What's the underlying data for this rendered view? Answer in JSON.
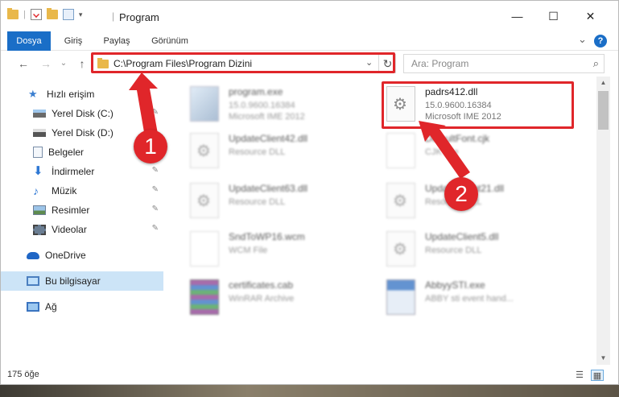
{
  "window": {
    "title": "Program",
    "qat_separator": "|",
    "minimize_glyph": "—",
    "maximize_glyph": "☐",
    "close_glyph": "✕"
  },
  "ribbon": {
    "tabs": [
      "Dosya",
      "Giriş",
      "Paylaş",
      "Görünüm"
    ],
    "expand_glyph": "⌄",
    "help_glyph": "?"
  },
  "nav": {
    "back": "←",
    "forward": "→",
    "recent": "⌄",
    "up": "↑",
    "address_path": "C:\\Program Files\\Program Dizini",
    "dropdown_glyph": "⌄",
    "refresh_glyph": "↻",
    "search_placeholder": "Ara: Program",
    "search_glyph": "⌕"
  },
  "sidebar": {
    "items": [
      {
        "label": "Hızlı erişim",
        "icon": "star-icon",
        "pinned": false
      },
      {
        "label": "Yerel Disk (C:)",
        "icon": "drive-icon",
        "pinned": true
      },
      {
        "label": "Yerel Disk (D:)",
        "icon": "drive-icon",
        "pinned": true
      },
      {
        "label": "Belgeler",
        "icon": "documents-icon",
        "pinned": false
      },
      {
        "label": "İndirmeler",
        "icon": "download-icon",
        "pinned": true
      },
      {
        "label": "Müzik",
        "icon": "music-icon",
        "pinned": true
      },
      {
        "label": "Resimler",
        "icon": "pictures-icon",
        "pinned": true
      },
      {
        "label": "Videolar",
        "icon": "videos-icon",
        "pinned": true
      },
      {
        "label": "OneDrive",
        "icon": "cloud-icon",
        "pinned": false
      },
      {
        "label": "Bu bilgisayar",
        "icon": "computer-icon",
        "pinned": false
      },
      {
        "label": "Ağ",
        "icon": "network-icon",
        "pinned": false
      }
    ],
    "pin_glyph": "📌"
  },
  "files": [
    {
      "name": "program.exe",
      "line2": "15.0.9600.16384",
      "line3": "Microsoft IME 2012",
      "icon": "exe-icon"
    },
    {
      "name": "padrs412.dll",
      "line2": "15.0.9600.16384",
      "line3": "Microsoft IME 2012",
      "icon": "dll-icon"
    },
    {
      "name": "UpdateClient42.dll",
      "line2": "Resource DLL",
      "line3": "",
      "icon": "dll-icon"
    },
    {
      "name": "DefaultFont.cjk",
      "line2": "CJK File",
      "line3": "",
      "icon": "file-icon"
    },
    {
      "name": "UpdateClient63.dll",
      "line2": "Resource DLL",
      "line3": "",
      "icon": "dll-icon"
    },
    {
      "name": "UpdateClient21.dll",
      "line2": "Resource DLL",
      "line3": "",
      "icon": "dll-icon"
    },
    {
      "name": "SndToWP16.wcm",
      "line2": "WCM File",
      "line3": "",
      "icon": "file-icon"
    },
    {
      "name": "UpdateClient5.dll",
      "line2": "Resource DLL",
      "line3": "",
      "icon": "dll-icon"
    },
    {
      "name": "certificates.cab",
      "line2": "WinRAR Archive",
      "line3": "",
      "icon": "archive-icon"
    },
    {
      "name": "AbbyySTI.exe",
      "line2": "ABBY sti event hand...",
      "line3": "",
      "icon": "exe-icon"
    }
  ],
  "status": {
    "count": "175 öğe",
    "details_view_glyph": "☰",
    "tiles_view_glyph": "▦"
  },
  "callouts": [
    "1",
    "2"
  ],
  "colors": {
    "accent": "#1a6ec7",
    "highlight": "#e0262a",
    "selected": "#cce4f7"
  }
}
